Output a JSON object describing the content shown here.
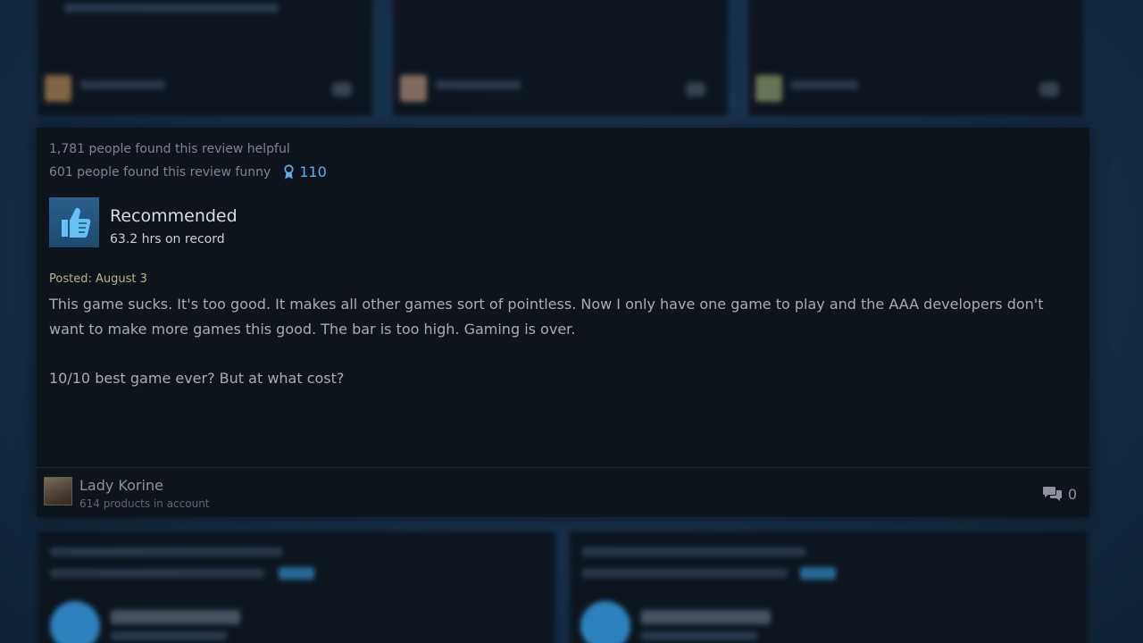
{
  "review": {
    "helpful_text": "1,781 people found this review helpful",
    "funny_text": "601 people found this review funny",
    "award_count": "110",
    "recommendation": "Recommended",
    "hours": "63.2 hrs on record",
    "posted": "Posted: August 3",
    "body_paragraph_1": "This game sucks. It's too good. It makes all other games sort of pointless. Now I only have one game to play and the AAA developers don't want to make more games this good. The bar is too high. Gaming is over.",
    "body_paragraph_2": "10/10 best game ever? But at what cost?",
    "author_name": "Lady Korine",
    "author_products": "614 products in account",
    "comment_count": "0"
  },
  "icons": {
    "award": "award-ribbon-icon",
    "thumb": "thumbs-up-icon",
    "comments": "speech-bubbles-icon"
  },
  "colors": {
    "card_background": "#0e141b",
    "accent_blue": "#5faee8",
    "posted_text": "#b9b28a"
  }
}
